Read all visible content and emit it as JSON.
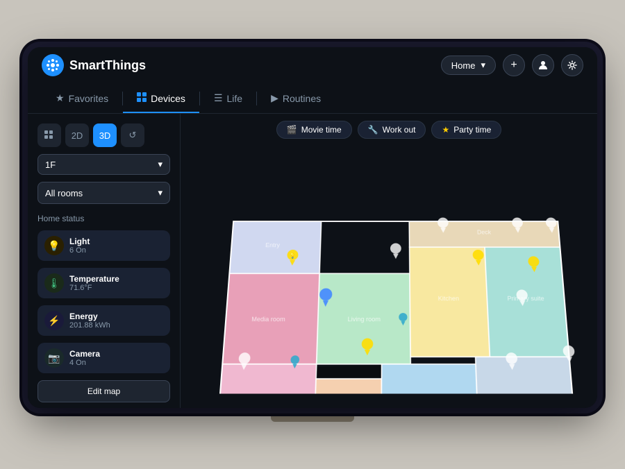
{
  "app": {
    "name": "SmartThings",
    "logo_icon": "⚙",
    "logo_bg": "#1e90ff"
  },
  "header": {
    "home_label": "Home",
    "add_btn": "+",
    "profile_icon": "👤",
    "settings_icon": "⚙"
  },
  "nav": {
    "tabs": [
      {
        "id": "favorites",
        "label": "Favorites",
        "icon": "★",
        "active": false
      },
      {
        "id": "devices",
        "label": "Devices",
        "icon": "⊞",
        "active": true
      },
      {
        "id": "life",
        "label": "Life",
        "icon": "☰",
        "active": false
      },
      {
        "id": "routines",
        "label": "Routines",
        "icon": "▶",
        "active": false
      }
    ]
  },
  "sidebar": {
    "view_controls": [
      {
        "id": "grid",
        "label": "⊞",
        "active": false
      },
      {
        "id": "2d",
        "label": "2D",
        "active": false
      },
      {
        "id": "3d",
        "label": "3D",
        "active": true
      },
      {
        "id": "history",
        "label": "↺",
        "active": false
      }
    ],
    "floor_select": {
      "value": "1F",
      "placeholder": "1F"
    },
    "room_select": {
      "value": "All rooms",
      "placeholder": "All rooms"
    },
    "home_status_title": "Home status",
    "status_items": [
      {
        "id": "light",
        "icon": "💡",
        "label": "Light",
        "value": "6 On",
        "type": "light"
      },
      {
        "id": "temperature",
        "icon": "🌡",
        "label": "Temperature",
        "value": "71.6°F",
        "type": "temp"
      },
      {
        "id": "energy",
        "icon": "⚡",
        "label": "Energy",
        "value": "201.88 kWh",
        "type": "energy"
      },
      {
        "id": "camera",
        "icon": "📷",
        "label": "Camera",
        "value": "4 On",
        "type": "camera"
      }
    ],
    "edit_map_btn": "Edit map"
  },
  "scenes": [
    {
      "id": "movie",
      "icon": "🎬",
      "label": "Movie time"
    },
    {
      "id": "workout",
      "icon": "🔧",
      "label": "Work out"
    },
    {
      "id": "party",
      "icon": "⭐",
      "label": "Party time"
    }
  ],
  "colors": {
    "bg_dark": "#0d1117",
    "bg_card": "#1a2233",
    "accent_blue": "#1e90ff",
    "text_muted": "#8899aa",
    "border": "#2a3545"
  }
}
